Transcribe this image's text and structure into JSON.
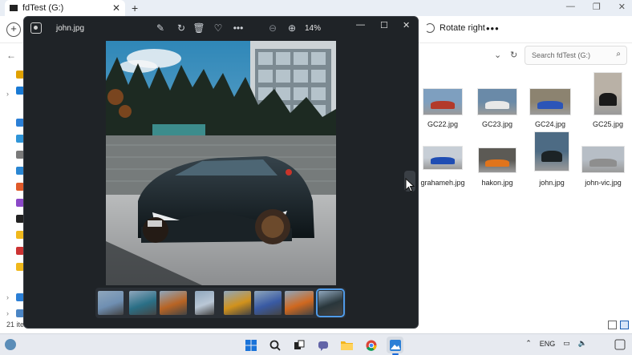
{
  "explorer": {
    "tab_title": "fdTest (G:)",
    "toolbar": {
      "rotate_label": "Rotate right"
    },
    "search_placeholder": "Search fdTest (G:)",
    "status_text": "21 ite",
    "files": [
      {
        "name": "GC22.jpg",
        "color": "#b33a2a",
        "bg": "#7e9fbf"
      },
      {
        "name": "GC23.jpg",
        "color": "#e8e8e8",
        "bg": "#6a8aa8"
      },
      {
        "name": "GC24.jpg",
        "color": "#2c55b8",
        "bg": "#8c8370"
      },
      {
        "name": "GC25.jpg",
        "color": "#1a1a1a",
        "bg": "#b9b1a6"
      },
      {
        "name": "grahameh.jpg",
        "color": "#1f4db3",
        "bg": "#c7ced6"
      },
      {
        "name": "hakon.jpg",
        "color": "#e0741c",
        "bg": "#5c5a55"
      },
      {
        "name": "john.jpg",
        "color": "#1c2326",
        "bg": "#4d6b84"
      },
      {
        "name": "john-vic.jpg",
        "color": "#8e8e8e",
        "bg": "#b7bec6"
      }
    ]
  },
  "viewer": {
    "file_name": "john.jpg",
    "zoom": "14%",
    "film_colors": [
      "#6f8fb2",
      "#2a6f86",
      "#b86424",
      "#bac7d6",
      "#d1921c",
      "#395aa3",
      "#d0681f",
      "#29363b"
    ]
  },
  "taskbar": {
    "language": "ENG"
  }
}
